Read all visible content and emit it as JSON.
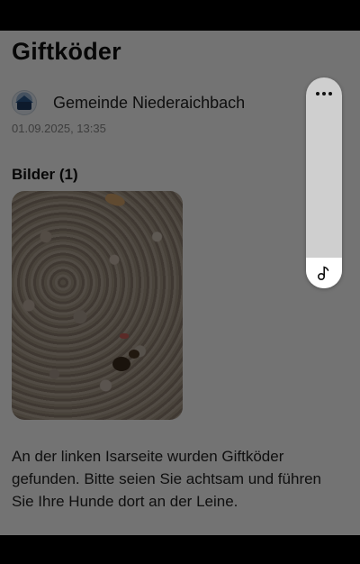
{
  "post": {
    "title": "Giftköder",
    "author": "Gemeinde Niederaichbach",
    "date": "01.09.2025, 13:35",
    "images_heading": "Bilder (1)",
    "body": "An der linken Isarseite wurden Giftköder gefunden. Bitte seien Sie achtsam und führen Sie Ihre Hunde dort an der Leine."
  },
  "overlay": {
    "more_icon": "more-horizontal-icon",
    "music_icon": "music-note-icon"
  },
  "colors": {
    "background": "#ffffff",
    "text": "#111111",
    "date": "#888888",
    "dim_overlay": "rgba(0,0,0,0.55)",
    "panel": "#cfcfcf"
  }
}
